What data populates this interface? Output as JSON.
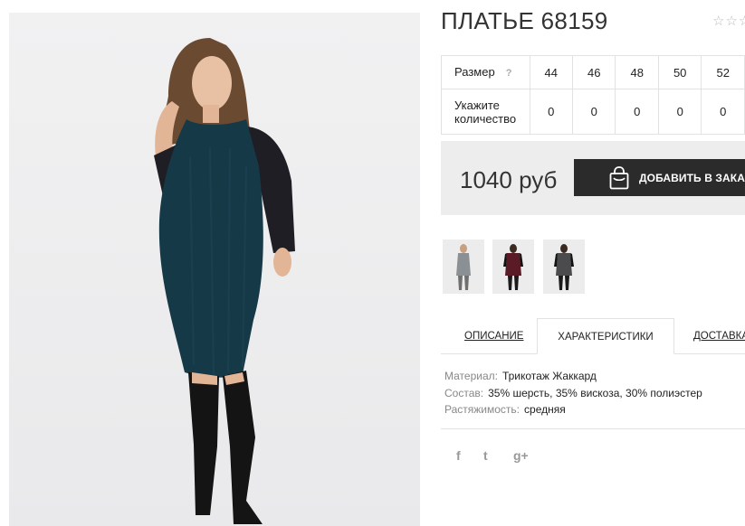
{
  "product": {
    "title": "ПЛАТЬЕ 68159",
    "rating_stars": "☆☆☆"
  },
  "size_table": {
    "size_label": "Размер",
    "help_label": "?",
    "sizes": [
      "44",
      "46",
      "48",
      "50",
      "52"
    ],
    "quantity_label_line1": "Укажите",
    "quantity_label_line2": "количество",
    "quantities": [
      "0",
      "0",
      "0",
      "0",
      "0"
    ]
  },
  "price": {
    "value": "1040 руб",
    "add_button_label": "ДОБАВИТЬ В ЗАКАЗ"
  },
  "thumbnails": [
    {
      "color": "gray-dress"
    },
    {
      "color": "burgundy-dress"
    },
    {
      "color": "charcoal-dress"
    }
  ],
  "tabs": {
    "description": "ОПИСАНИЕ",
    "characteristics": "ХАРАКТЕРИСТИКИ",
    "delivery": "ДОСТАВКА"
  },
  "characteristics": [
    {
      "key": "Материал:",
      "value": "Трикотаж Жаккард"
    },
    {
      "key": "Состав:",
      "value": "35% шерсть, 35% вискоза, 30% полиэстер"
    },
    {
      "key": "Растяжимость:",
      "value": "средняя"
    }
  ],
  "social": {
    "facebook": "f",
    "twitter": "t",
    "googleplus": "g+"
  },
  "colors": {
    "dress": "#163947",
    "button": "#2b2b2b",
    "price_bg": "#ededed"
  }
}
